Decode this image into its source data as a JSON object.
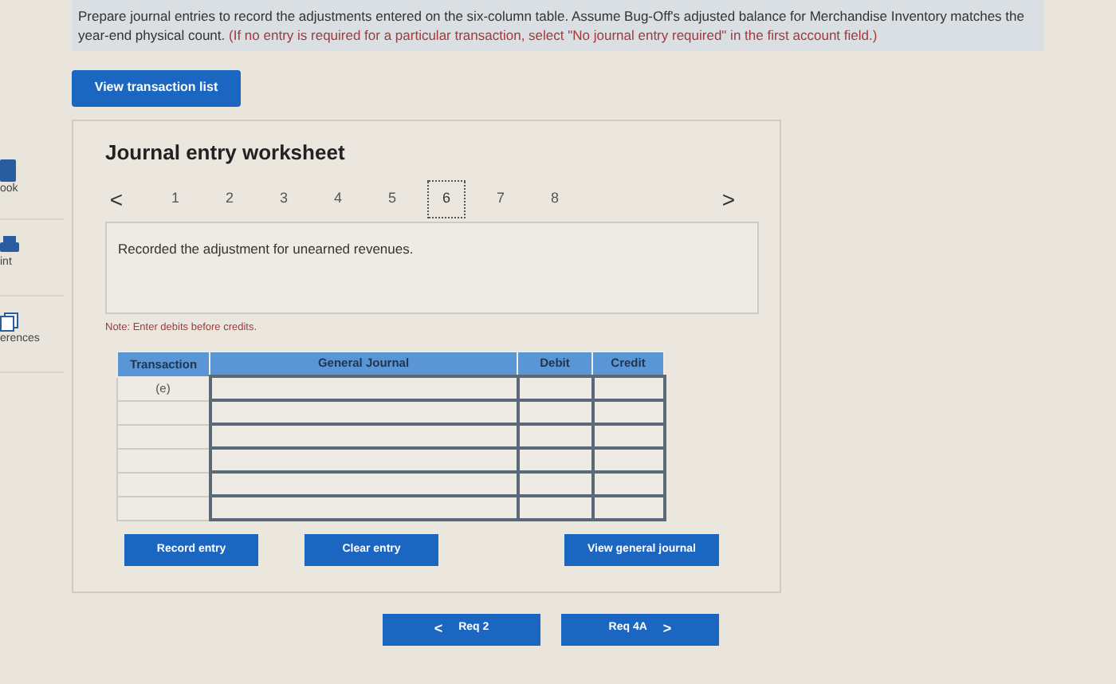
{
  "sidebar": {
    "items": [
      {
        "label": "ook"
      },
      {
        "label": "int"
      },
      {
        "label": "erences"
      }
    ]
  },
  "instructions": {
    "text": "Prepare journal entries to record the adjustments entered on the six-column table. Assume Bug-Off's adjusted balance for Merchandise Inventory matches the year-end physical count.",
    "hint": "(If no entry is required for a particular transaction, select \"No journal entry required\" in the first account field.)"
  },
  "view_transaction_list": "View transaction list",
  "worksheet": {
    "title": "Journal entry worksheet",
    "prev": "<",
    "next": ">",
    "tabs": [
      {
        "label": "1",
        "selected": false
      },
      {
        "label": "2",
        "selected": false
      },
      {
        "label": "3",
        "selected": false
      },
      {
        "label": "4",
        "selected": false
      },
      {
        "label": "5",
        "selected": false
      },
      {
        "label": "6",
        "selected": true
      },
      {
        "label": "7",
        "selected": false
      },
      {
        "label": "8",
        "selected": false
      }
    ],
    "description": "Recorded the adjustment for unearned revenues.",
    "note": "Note: Enter debits before credits.",
    "table": {
      "columns": [
        "Transaction",
        "General Journal",
        "Debit",
        "Credit"
      ],
      "rows": [
        {
          "transaction": "(e)"
        },
        {},
        {},
        {},
        {},
        {}
      ]
    },
    "buttons": [
      "Record entry",
      "Clear entry",
      "View general journal"
    ]
  },
  "nav": [
    {
      "label": "Req 2",
      "arrow": "<"
    },
    {
      "label": "Req 4A",
      "arrow": ">"
    }
  ]
}
